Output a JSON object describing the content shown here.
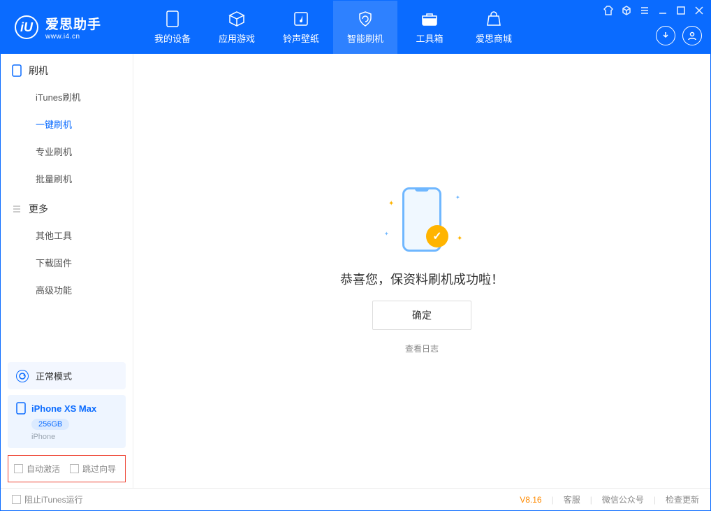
{
  "app": {
    "name": "爱思助手",
    "url": "www.i4.cn"
  },
  "tabs": {
    "device": "我的设备",
    "apps": "应用游戏",
    "ring": "铃声壁纸",
    "flash": "智能刷机",
    "tools": "工具箱",
    "store": "爱思商城"
  },
  "sidebar": {
    "section_flash": "刷机",
    "items_flash": {
      "itunes": "iTunes刷机",
      "oneclick": "一键刷机",
      "pro": "专业刷机",
      "batch": "批量刷机"
    },
    "section_more": "更多",
    "items_more": {
      "other": "其他工具",
      "firmware": "下载固件",
      "advanced": "高级功能"
    },
    "status_mode": "正常模式",
    "device_name": "iPhone XS Max",
    "device_storage": "256GB",
    "device_type": "iPhone",
    "cb_auto": "自动激活",
    "cb_skip": "跳过向导"
  },
  "main": {
    "success": "恭喜您，保资料刷机成功啦！",
    "ok": "确定",
    "view_log": "查看日志"
  },
  "footer": {
    "block_itunes": "阻止iTunes运行",
    "version": "V8.16",
    "support": "客服",
    "wechat": "微信公众号",
    "update": "检查更新"
  }
}
